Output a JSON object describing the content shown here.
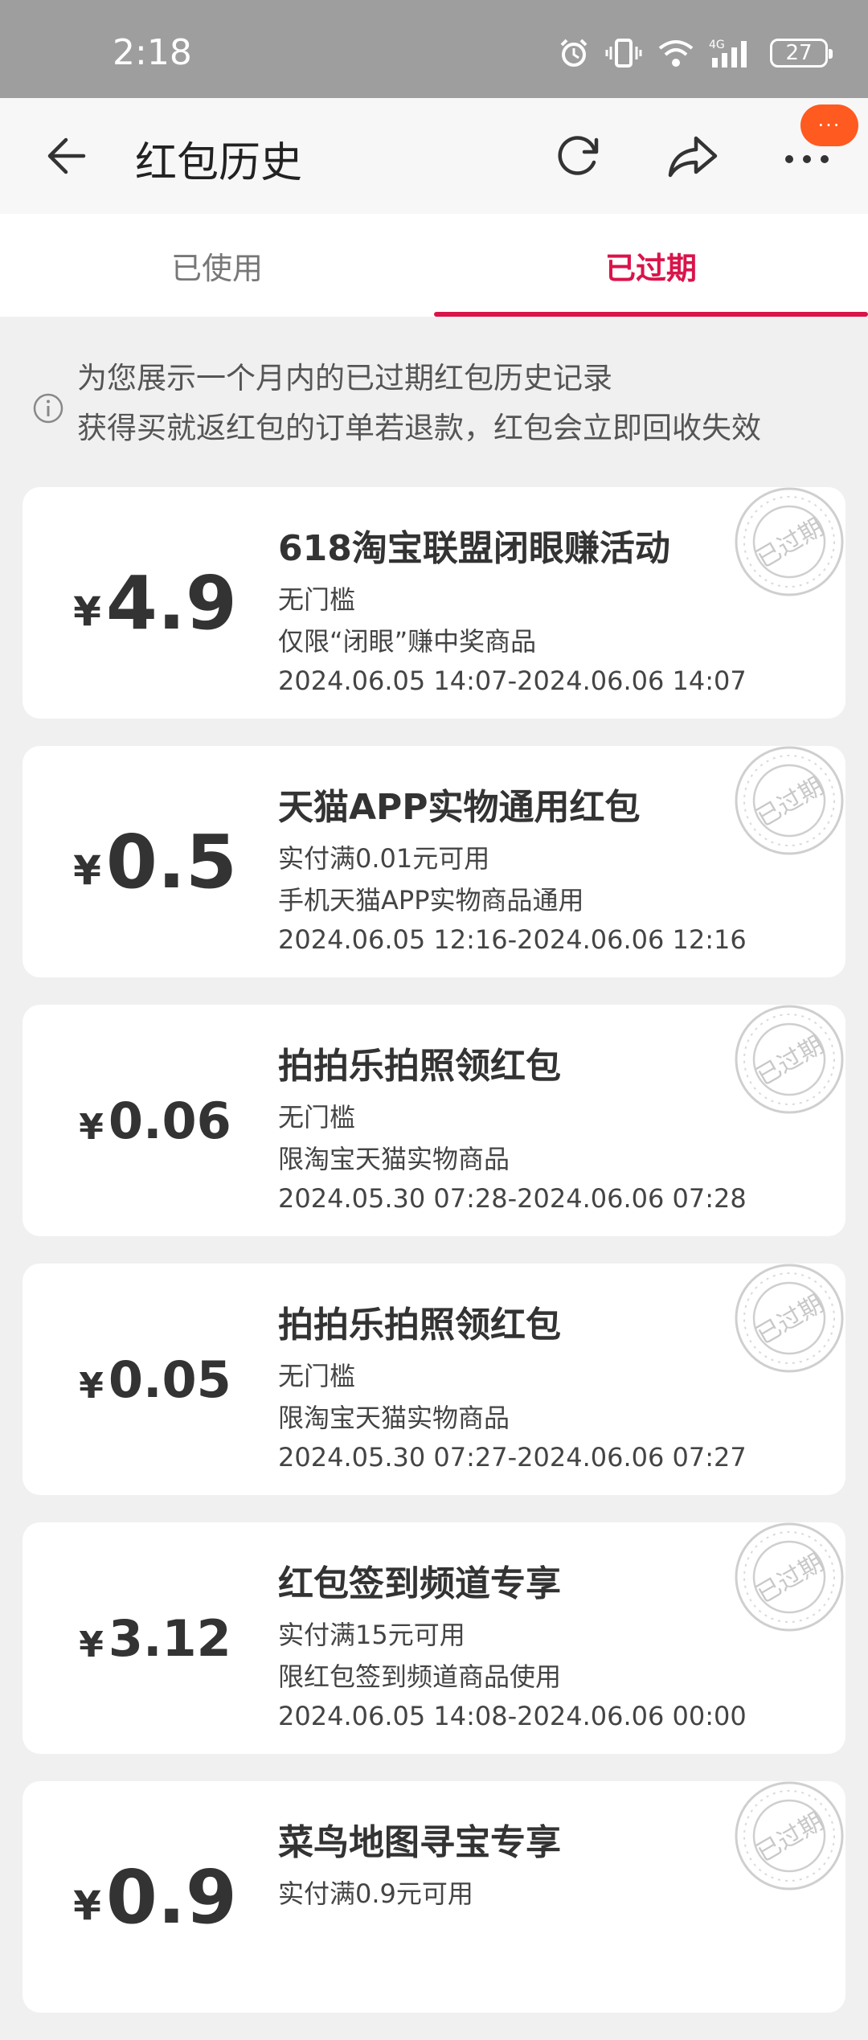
{
  "status_bar": {
    "time": "2:18",
    "network": "4G",
    "battery": "27"
  },
  "header": {
    "title": "红包历史",
    "badge": "···"
  },
  "tabs": [
    {
      "label": "已使用",
      "active": false
    },
    {
      "label": "已过期",
      "active": true
    }
  ],
  "notice": {
    "line1": "为您展示一个月内的已过期红包历史记录",
    "line2": "获得买就返红包的订单若退款，红包会立即回收失效"
  },
  "stamp_text": "已过期",
  "currency": "¥",
  "cards": [
    {
      "amount": "4.9",
      "title": "618淘宝联盟闭眼赚活动",
      "threshold": "无门槛",
      "scope": "仅限“闭眼”赚中奖商品",
      "period": "2024.06.05 14:07-2024.06.06 14:07"
    },
    {
      "amount": "0.5",
      "title": "天猫APP实物通用红包",
      "threshold": "实付满0.01元可用",
      "scope": "手机天猫APP实物商品通用",
      "period": "2024.06.05 12:16-2024.06.06 12:16"
    },
    {
      "amount": "0.06",
      "title": "拍拍乐拍照领红包",
      "threshold": "无门槛",
      "scope": "限淘宝天猫实物商品",
      "period": "2024.05.30 07:28-2024.06.06 07:28"
    },
    {
      "amount": "0.05",
      "title": "拍拍乐拍照领红包",
      "threshold": "无门槛",
      "scope": "限淘宝天猫实物商品",
      "period": "2024.05.30 07:27-2024.06.06 07:27"
    },
    {
      "amount": "3.12",
      "title": "红包签到频道专享",
      "threshold": "实付满15元可用",
      "scope": "限红包签到频道商品使用",
      "period": "2024.06.05 14:08-2024.06.06 00:00"
    },
    {
      "amount": "0.9",
      "title": "菜鸟地图寻宝专享",
      "threshold": "实付满0.9元可用",
      "scope": "",
      "period": ""
    }
  ],
  "colors": {
    "accent": "#d9144a",
    "badge": "#ff5a1f",
    "status_bar": "#9e9e9e"
  }
}
